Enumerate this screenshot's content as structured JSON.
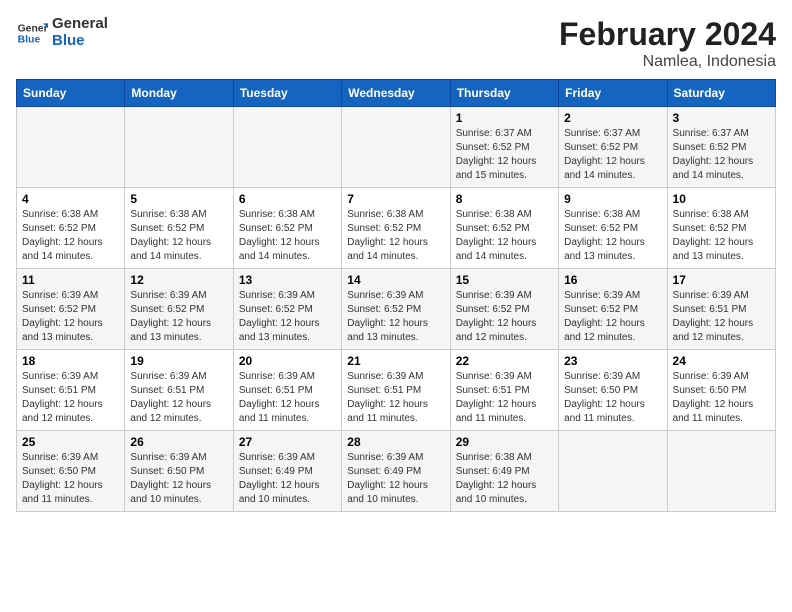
{
  "header": {
    "logo_line1": "General",
    "logo_line2": "Blue",
    "title": "February 2024",
    "subtitle": "Namlea, Indonesia"
  },
  "weekdays": [
    "Sunday",
    "Monday",
    "Tuesday",
    "Wednesday",
    "Thursday",
    "Friday",
    "Saturday"
  ],
  "weeks": [
    [
      {
        "day": "",
        "info": ""
      },
      {
        "day": "",
        "info": ""
      },
      {
        "day": "",
        "info": ""
      },
      {
        "day": "",
        "info": ""
      },
      {
        "day": "1",
        "info": "Sunrise: 6:37 AM\nSunset: 6:52 PM\nDaylight: 12 hours and 15 minutes."
      },
      {
        "day": "2",
        "info": "Sunrise: 6:37 AM\nSunset: 6:52 PM\nDaylight: 12 hours and 14 minutes."
      },
      {
        "day": "3",
        "info": "Sunrise: 6:37 AM\nSunset: 6:52 PM\nDaylight: 12 hours and 14 minutes."
      }
    ],
    [
      {
        "day": "4",
        "info": "Sunrise: 6:38 AM\nSunset: 6:52 PM\nDaylight: 12 hours and 14 minutes."
      },
      {
        "day": "5",
        "info": "Sunrise: 6:38 AM\nSunset: 6:52 PM\nDaylight: 12 hours and 14 minutes."
      },
      {
        "day": "6",
        "info": "Sunrise: 6:38 AM\nSunset: 6:52 PM\nDaylight: 12 hours and 14 minutes."
      },
      {
        "day": "7",
        "info": "Sunrise: 6:38 AM\nSunset: 6:52 PM\nDaylight: 12 hours and 14 minutes."
      },
      {
        "day": "8",
        "info": "Sunrise: 6:38 AM\nSunset: 6:52 PM\nDaylight: 12 hours and 14 minutes."
      },
      {
        "day": "9",
        "info": "Sunrise: 6:38 AM\nSunset: 6:52 PM\nDaylight: 12 hours and 13 minutes."
      },
      {
        "day": "10",
        "info": "Sunrise: 6:38 AM\nSunset: 6:52 PM\nDaylight: 12 hours and 13 minutes."
      }
    ],
    [
      {
        "day": "11",
        "info": "Sunrise: 6:39 AM\nSunset: 6:52 PM\nDaylight: 12 hours and 13 minutes."
      },
      {
        "day": "12",
        "info": "Sunrise: 6:39 AM\nSunset: 6:52 PM\nDaylight: 12 hours and 13 minutes."
      },
      {
        "day": "13",
        "info": "Sunrise: 6:39 AM\nSunset: 6:52 PM\nDaylight: 12 hours and 13 minutes."
      },
      {
        "day": "14",
        "info": "Sunrise: 6:39 AM\nSunset: 6:52 PM\nDaylight: 12 hours and 13 minutes."
      },
      {
        "day": "15",
        "info": "Sunrise: 6:39 AM\nSunset: 6:52 PM\nDaylight: 12 hours and 12 minutes."
      },
      {
        "day": "16",
        "info": "Sunrise: 6:39 AM\nSunset: 6:52 PM\nDaylight: 12 hours and 12 minutes."
      },
      {
        "day": "17",
        "info": "Sunrise: 6:39 AM\nSunset: 6:51 PM\nDaylight: 12 hours and 12 minutes."
      }
    ],
    [
      {
        "day": "18",
        "info": "Sunrise: 6:39 AM\nSunset: 6:51 PM\nDaylight: 12 hours and 12 minutes."
      },
      {
        "day": "19",
        "info": "Sunrise: 6:39 AM\nSunset: 6:51 PM\nDaylight: 12 hours and 12 minutes."
      },
      {
        "day": "20",
        "info": "Sunrise: 6:39 AM\nSunset: 6:51 PM\nDaylight: 12 hours and 11 minutes."
      },
      {
        "day": "21",
        "info": "Sunrise: 6:39 AM\nSunset: 6:51 PM\nDaylight: 12 hours and 11 minutes."
      },
      {
        "day": "22",
        "info": "Sunrise: 6:39 AM\nSunset: 6:51 PM\nDaylight: 12 hours and 11 minutes."
      },
      {
        "day": "23",
        "info": "Sunrise: 6:39 AM\nSunset: 6:50 PM\nDaylight: 12 hours and 11 minutes."
      },
      {
        "day": "24",
        "info": "Sunrise: 6:39 AM\nSunset: 6:50 PM\nDaylight: 12 hours and 11 minutes."
      }
    ],
    [
      {
        "day": "25",
        "info": "Sunrise: 6:39 AM\nSunset: 6:50 PM\nDaylight: 12 hours and 11 minutes."
      },
      {
        "day": "26",
        "info": "Sunrise: 6:39 AM\nSunset: 6:50 PM\nDaylight: 12 hours and 10 minutes."
      },
      {
        "day": "27",
        "info": "Sunrise: 6:39 AM\nSunset: 6:49 PM\nDaylight: 12 hours and 10 minutes."
      },
      {
        "day": "28",
        "info": "Sunrise: 6:39 AM\nSunset: 6:49 PM\nDaylight: 12 hours and 10 minutes."
      },
      {
        "day": "29",
        "info": "Sunrise: 6:38 AM\nSunset: 6:49 PM\nDaylight: 12 hours and 10 minutes."
      },
      {
        "day": "",
        "info": ""
      },
      {
        "day": "",
        "info": ""
      }
    ]
  ]
}
